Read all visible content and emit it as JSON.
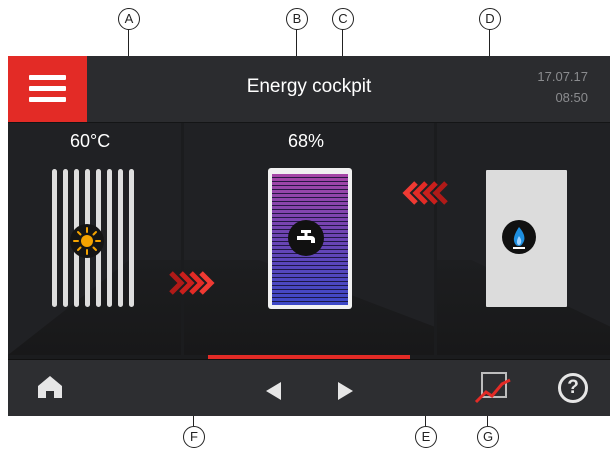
{
  "app": {
    "title": "Energy cockpit",
    "date": "17.07.17",
    "time": "08:50"
  },
  "panels": {
    "solar": {
      "value": "60°C",
      "icon": "sun-icon"
    },
    "storage": {
      "value": "68%",
      "icon": "tap-icon"
    },
    "boiler": {
      "icon": "gas-flame-icon"
    }
  },
  "bottom_nav": {
    "home_icon": "home-icon",
    "prev_icon": "prev-arrow-icon",
    "next_icon": "next-arrow-icon",
    "chart_icon": "chart-icon",
    "help_label": "?"
  },
  "callouts": [
    "A",
    "B",
    "C",
    "D",
    "E",
    "F",
    "G"
  ],
  "colors": {
    "accent": "#e32b26",
    "background": "#1b1c1e",
    "tank_top": "#a646a6",
    "tank_bottom": "#3d48c7",
    "flame": "#1e8fe0",
    "sun": "#f5a300"
  }
}
